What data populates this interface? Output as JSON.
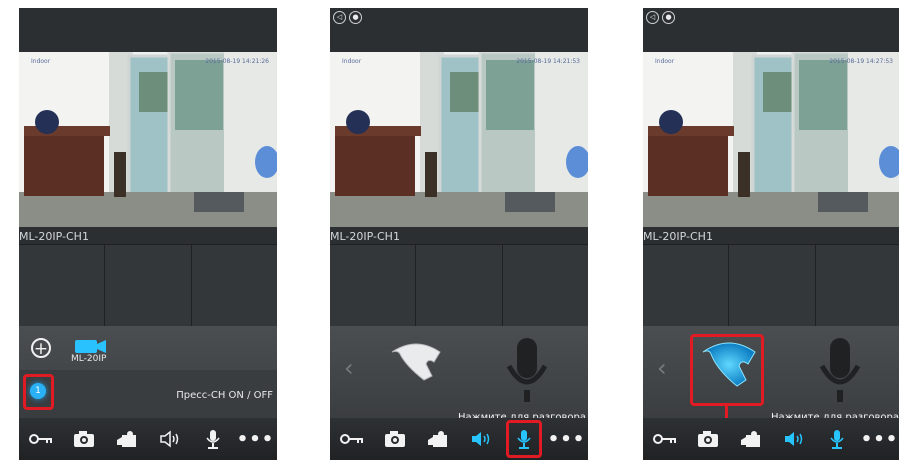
{
  "screens": [
    {
      "camera_name": "ML-20IP-CH1",
      "osd_left": "Indoor",
      "osd_time": "2015-08-19 14:21:26",
      "add_icon": "plus-circle-icon",
      "device_label": "ML-20IP",
      "channel_number": "1",
      "channel_action": "Пресс-CH ON / OFF",
      "toolbar": [
        "key-icon",
        "camera-icon",
        "video-record-icon",
        "speaker-icon",
        "mic-icon",
        "more-icon"
      ]
    },
    {
      "camera_name": "ML-20IP-CH1",
      "osd_left": "Indoor",
      "osd_time": "2015-08-19 14:21:53",
      "status_icons": [
        "speaker-status-icon",
        "mic-status-icon"
      ],
      "hint": "Нажмите для разговора",
      "toolbar": [
        "key-icon",
        "camera-icon",
        "video-record-icon",
        "speaker-icon",
        "mic-icon",
        "more-icon"
      ]
    },
    {
      "camera_name": "ML-20IP-CH1",
      "osd_left": "Indoor",
      "osd_time": "2015-08-19 14:27:53",
      "status_icons": [
        "speaker-status-icon",
        "mic-status-icon"
      ],
      "hint": "Нажмите для разговора",
      "toolbar": [
        "key-icon",
        "camera-icon",
        "video-record-icon",
        "speaker-icon",
        "mic-icon",
        "more-icon"
      ]
    }
  ],
  "colors": {
    "accent": "#27c4ff",
    "highlight": "#e01b23",
    "background": "#2f3235"
  }
}
